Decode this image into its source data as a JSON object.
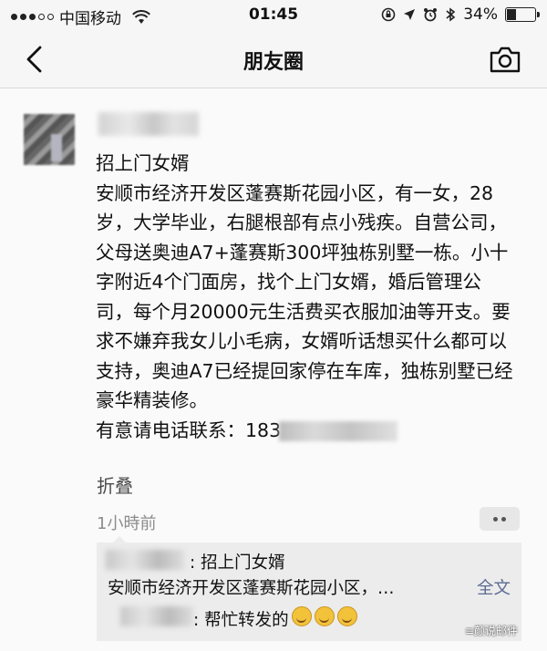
{
  "status_bar": {
    "carrier": "中国移动",
    "time": "01:45",
    "battery_text": "34%",
    "battery_level": 0.34
  },
  "nav": {
    "title": "朋友圈",
    "back_icon": "chevron-left-icon",
    "camera_icon": "camera-icon"
  },
  "post": {
    "title": "招上门女婿",
    "body": "安顺市经济开发区蓬赛斯花园小区，有一女，28岁，大学毕业，右腿根部有点小残疾。自营公司，父母送奥迪A7+蓬赛斯300坪独栋别墅一栋。小十字附近4个门面房，找个上门女婿，婚后管理公司，每个月20000元生活费买衣服加油等开支。要求不嫌弃我女儿小毛病，女婿听话想买什么都可以支持，奥迪A7已经提回家停在车库，独栋别墅已经豪华精装修。",
    "contact_prefix": "有意请电话联系：",
    "phone_visible": "183",
    "collapse_label": "折叠",
    "time": "1小時前"
  },
  "comments": [
    {
      "text": ": 招上门女婿",
      "line2": "安顺市经济开发区蓬赛斯花园小区，…",
      "full_text_label": "全文"
    },
    {
      "text": ": 帮忙转发的",
      "emoji_count": 3
    }
  ],
  "watermark": "≡颜说邮件"
}
